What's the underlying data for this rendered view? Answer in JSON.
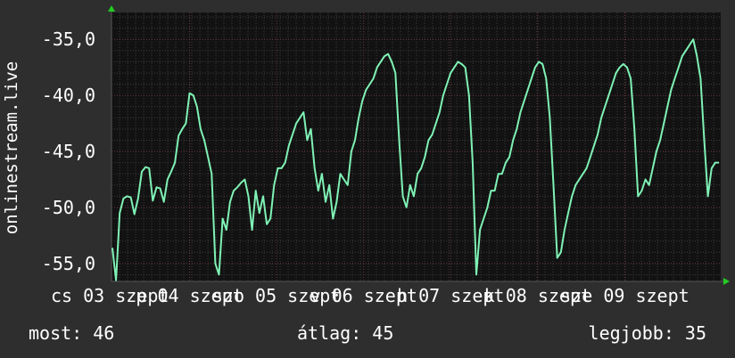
{
  "chart_data": {
    "type": "line",
    "ylabel": "onlinestream.live",
    "ylim": [
      -56.6,
      -32.6
    ],
    "yticks": [
      "-35,0",
      "-40,0",
      "-45,0",
      "-50,0",
      "-55,0"
    ],
    "ytick_values": [
      -35,
      -40,
      -45,
      -50,
      -55
    ],
    "xtick_labels": [
      "cs 03 szept",
      "p 04 szept",
      "szo 05 szept",
      "v 06 szept",
      "h 07 szept",
      "k 08 szept",
      "sze 09 szept"
    ],
    "grid": true,
    "colors": {
      "background": "#121212",
      "line": "#7ff2b5",
      "major_grid": "#6a3a44",
      "minor_grid": "#3c3c3c",
      "axis_arrow": "#22cc22"
    },
    "series": [
      {
        "values": [
          -53.6,
          -56.5,
          -50.5,
          -49.2,
          -49.0,
          -49.1,
          -50.6,
          -49.2,
          -46.8,
          -46.4,
          -46.5,
          -49.4,
          -48.2,
          -48.3,
          -49.5,
          -47.5,
          -46.8,
          -46.0,
          -43.6,
          -43.0,
          -42.5,
          -39.8,
          -40.0,
          -41.0,
          -43.0,
          -44.0,
          -45.5,
          -47.0,
          -55.0,
          -56.0,
          -51.0,
          -52.0,
          -49.5,
          -48.5,
          -48.2,
          -47.8,
          -47.5,
          -49.0,
          -52.0,
          -48.5,
          -50.5,
          -49.0,
          -51.5,
          -51.0,
          -48.0,
          -46.5,
          -46.5,
          -46.0,
          -44.5,
          -43.5,
          -42.5,
          -42.0,
          -41.5,
          -44.0,
          -43.0,
          -46.5,
          -48.5,
          -47.0,
          -49.5,
          -48.0,
          -51.0,
          -49.5,
          -47.0,
          -47.5,
          -48.0,
          -45.0,
          -44.0,
          -42.0,
          -40.5,
          -39.5,
          -39.0,
          -38.5,
          -37.5,
          -37.0,
          -36.5,
          -36.3,
          -37.0,
          -38.0,
          -44.0,
          -49.0,
          -50.0,
          -48.0,
          -49.0,
          -47.0,
          -46.5,
          -45.5,
          -44.0,
          -43.5,
          -42.5,
          -41.5,
          -40.0,
          -39.0,
          -38.0,
          -37.5,
          -37.0,
          -37.2,
          -37.5,
          -40.0,
          -46.0,
          -56.0,
          -52.0,
          -51.0,
          -50.0,
          -48.5,
          -48.5,
          -47.0,
          -47.0,
          -46.0,
          -45.5,
          -44.0,
          -43.0,
          -41.5,
          -40.5,
          -39.5,
          -38.5,
          -37.5,
          -37.0,
          -37.2,
          -38.5,
          -42.0,
          -48.0,
          -54.5,
          -54.0,
          -52.0,
          -50.5,
          -49.0,
          -48.0,
          -47.5,
          -47.0,
          -46.5,
          -45.5,
          -44.5,
          -43.5,
          -42.0,
          -41.0,
          -40.0,
          -39.0,
          -38.0,
          -37.5,
          -37.2,
          -37.5,
          -38.5,
          -43.0,
          -49.0,
          -48.5,
          -47.5,
          -48.0,
          -46.5,
          -45.0,
          -44.0,
          -42.5,
          -41.0,
          -39.5,
          -38.5,
          -37.5,
          -36.5,
          -36.0,
          -35.5,
          -35.0,
          -36.5,
          -38.5,
          -44.0,
          -49.0,
          -46.5,
          -46.0,
          -46.0
        ]
      }
    ]
  },
  "footer": {
    "most": "most: 46",
    "atlag": "átlag: 45",
    "legjobb": "legjobb: 35"
  }
}
